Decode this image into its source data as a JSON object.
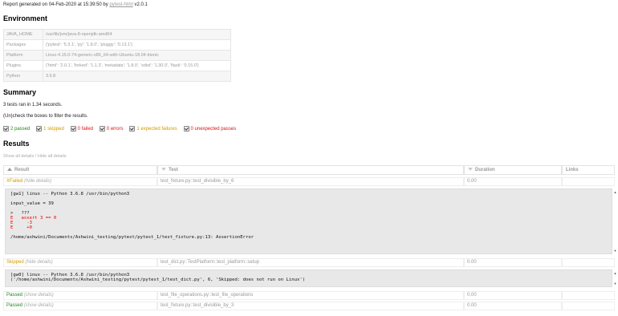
{
  "report": {
    "prefix": "Report generated on 04-Feb-2020 at 15:39:50 by ",
    "link": "pytest-html",
    "version": " v2.0.1"
  },
  "environment": {
    "heading": "Environment",
    "rows": [
      {
        "key": "JAVA_HOME",
        "value": "/usr/lib/jvm/java-8-openjdk-amd64"
      },
      {
        "key": "Packages",
        "value": "{'pytest': '5.3.1', 'py': '1.8.0', 'pluggy': '0.13.1'}"
      },
      {
        "key": "Platform",
        "value": "Linux-4.15.0-74-generic-x86_64-with-Ubuntu-18.04-bionic"
      },
      {
        "key": "Plugins",
        "value": "{'html': '2.0.1', 'forked': '1.1.3', 'metadata': '1.8.0', 'xdist': '1.30.0', 'flask': '0.15.0'}"
      },
      {
        "key": "Python",
        "value": "3.6.8"
      }
    ]
  },
  "summary": {
    "heading": "Summary",
    "ran": "3 tests ran in 1.34 seconds.",
    "hint": "(Un)check the boxes to filter the results.",
    "filters": [
      {
        "label": "2 passed",
        "cls": "passed"
      },
      {
        "label": "1 skipped",
        "cls": "skipped"
      },
      {
        "label": "0 failed",
        "cls": "failed"
      },
      {
        "label": "0 errors",
        "cls": "failed"
      },
      {
        "label": "1 expected failures",
        "cls": "xfailed"
      },
      {
        "label": "0 unexpected passes",
        "cls": "xpassed"
      }
    ]
  },
  "results": {
    "heading": "Results",
    "show_all": "Show all details",
    "sep": " / ",
    "hide_all": "Hide all details",
    "columns": [
      "Result",
      "Test",
      "Duration",
      "Links"
    ],
    "rows": [
      {
        "result": "XFailed",
        "details": "(hide details)",
        "test": "test_fixture.py::test_divisible_by_6",
        "duration": "0.00",
        "cls": "xfailed"
      },
      {
        "result": "Skipped",
        "details": "(hide details)",
        "test": "test_dict.py::TestPlatform::test_platform::setup",
        "duration": "0.00",
        "cls": "skipped"
      },
      {
        "result": "Passed",
        "details": "(show details)",
        "test": "test_file_operations.py::test_file_operations",
        "duration": "0.00",
        "cls": "passed"
      },
      {
        "result": "Passed",
        "details": "(show details)",
        "test": "test_fixture.py::test_divisible_by_3",
        "duration": "0.00",
        "cls": "passed"
      }
    ],
    "log1": {
      "l1": "[gw1] linux -- Python 3.6.8 /usr/bin/python3",
      "l2": "input_value = 39",
      "l3": ">   ???",
      "l4": "E   assert 3 == 0",
      "l5": "E     -3",
      "l6": "E     +0",
      "l7": "/home/ashwini/Documents/Ashwini_testing/pytest/pytest_1/test_fixture.py:13: AssertionError"
    },
    "log2": {
      "l1": "[gw0] linux -- Python 3.6.8 /usr/bin/python3",
      "l2": "('/home/ashwini/Documents/Ashwini_testing/pytest/pytest_1/test_dict.py', 6, 'Skipped: does not run on Linux')"
    }
  }
}
